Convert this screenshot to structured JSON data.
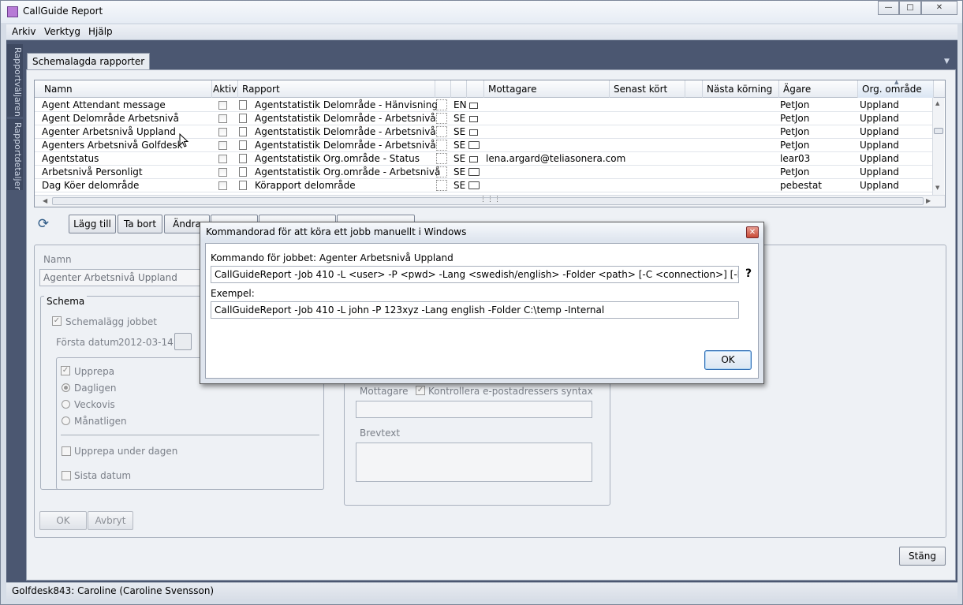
{
  "window": {
    "title": "CallGuide Report"
  },
  "menu": [
    "Arkiv",
    "Verktyg",
    "Hjälp"
  ],
  "side_tabs": [
    "Rapportväljaren",
    "Rapportdetaljer"
  ],
  "tab": "Schemalagda rapporter",
  "grid": {
    "columns": [
      "Namn",
      "Aktiv",
      "Rapport",
      "Mottagare",
      "Senast kört",
      "Nästa körning",
      "Ägare",
      "Org. område"
    ],
    "rows": [
      {
        "name": "Agent Attendant message",
        "report": "Agentstatistik Delområde - Hänvisning",
        "lang": "EN",
        "delivery": "mail",
        "recipient": "",
        "owner": "PetJon",
        "org": "Uppland"
      },
      {
        "name": "Agent Delområde Arbetsnivå",
        "report": "Agentstatistik Delområde - Arbetsnivå",
        "lang": "SE",
        "delivery": "mail",
        "recipient": "",
        "owner": "PetJon",
        "org": "Uppland"
      },
      {
        "name": "Agenter Arbetsnivå Uppland",
        "report": "Agentstatistik Delområde - Arbetsnivå",
        "lang": "SE",
        "delivery": "mail",
        "recipient": "",
        "owner": "PetJon",
        "org": "Uppland"
      },
      {
        "name": "Agenters Arbetsnivå Golfdesk",
        "report": "Agentstatistik Delområde - Arbetsnivå",
        "lang": "SE",
        "delivery": "folder",
        "recipient": "",
        "owner": "PetJon",
        "org": "Uppland"
      },
      {
        "name": "Agentstatus",
        "report": "Agentstatistik Org.område - Status",
        "lang": "SE",
        "delivery": "mail",
        "recipient": "lena.argard@teliasonera.com",
        "owner": "lear03",
        "org": "Uppland"
      },
      {
        "name": "Arbetsnivå Personligt",
        "report": "Agentstatistik Org.område - Arbetsnivå",
        "lang": "SE",
        "delivery": "folder",
        "recipient": "",
        "owner": "PetJon",
        "org": "Uppland"
      },
      {
        "name": "Dag Köer delområde",
        "report": "Körapport delområde",
        "lang": "SE",
        "delivery": "folder",
        "recipient": "",
        "owner": "pebestat",
        "org": "Uppland"
      }
    ]
  },
  "toolbar": {
    "add": "Lägg till",
    "remove": "Ta bort",
    "change": "Ändra"
  },
  "form": {
    "name_label": "Namn",
    "name_value": "Agenter Arbetsnivå Uppland",
    "schema_legend": "Schema",
    "schedule_job": "Schemalägg jobbet",
    "first_date_label": "Första datum",
    "first_date_value": "2012-03-14",
    "repeat": "Upprepa",
    "daily": "Dagligen",
    "weekly": "Veckovis",
    "monthly": "Månatligen",
    "repeat_day": "Upprepa under dagen",
    "last_date": "Sista datum",
    "ok": "OK",
    "cancel": "Avbryt",
    "recipient_label": "Mottagare",
    "check_syntax": "Kontrollera e-postadressers syntax",
    "body_label": "Brevtext"
  },
  "close_button": "Stäng",
  "status": "Golfdesk843: Caroline (Caroline Svensson)",
  "dialog": {
    "title": "Kommandorad för att köra ett jobb manuellt i Windows",
    "command_label": "Kommando för jobbet: Agenter Arbetsnivå Uppland",
    "command_value": "CallGuideReport -Job 410 -L <user> -P <pwd> -Lang <swedish/english> -Folder <path> [-C <connection>] [-Internal]",
    "help": "?",
    "example_label": "Exempel:",
    "example_value": "CallGuideReport -Job 410 -L john -P 123xyz -Lang english -Folder C:\\temp -Internal",
    "ok": "OK"
  }
}
